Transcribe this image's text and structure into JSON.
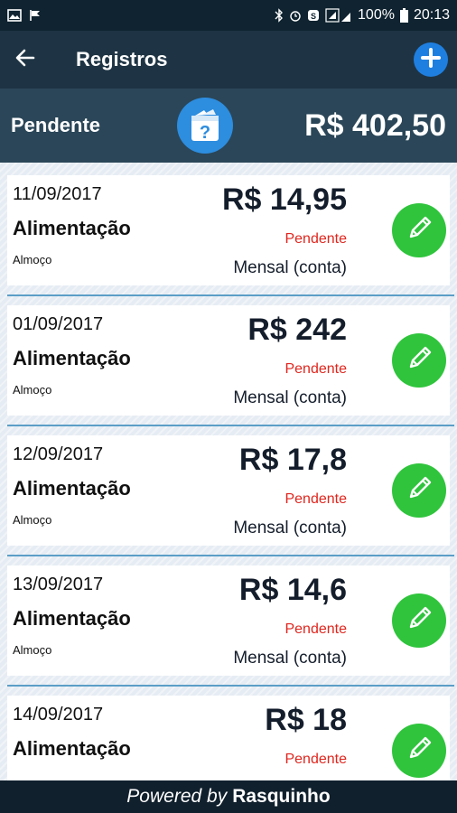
{
  "statusbar": {
    "battery": "100%",
    "time": "20:13"
  },
  "appbar": {
    "title": "Registros"
  },
  "summary": {
    "label": "Pendente",
    "total": "R$ 402,50"
  },
  "records": [
    {
      "date": "11/09/2017",
      "category": "Alimentação",
      "subcategory": "Almoço",
      "amount": "R$ 14,95",
      "status": "Pendente",
      "frequency": "Mensal (conta)"
    },
    {
      "date": "01/09/2017",
      "category": "Alimentação",
      "subcategory": "Almoço",
      "amount": "R$ 242",
      "status": "Pendente",
      "frequency": "Mensal (conta)"
    },
    {
      "date": "12/09/2017",
      "category": "Alimentação",
      "subcategory": "Almoço",
      "amount": "R$ 17,8",
      "status": "Pendente",
      "frequency": "Mensal (conta)"
    },
    {
      "date": "13/09/2017",
      "category": "Alimentação",
      "subcategory": "Almoço",
      "amount": "R$ 14,6",
      "status": "Pendente",
      "frequency": "Mensal (conta)"
    },
    {
      "date": "14/09/2017",
      "category": "Alimentação",
      "subcategory": "",
      "amount": "R$ 18",
      "status": "Pendente",
      "frequency": ""
    }
  ],
  "footer": {
    "powered": "Powered by",
    "brand": "Rasquinho"
  },
  "colors": {
    "appbar": "#1e3444",
    "summary": "#2a4658",
    "add_button": "#1f7fe0",
    "edit_button": "#2fc43c",
    "status_pending": "#e0251d"
  },
  "icons": {
    "back": "arrow-left-icon",
    "add": "plus-circle-icon",
    "summary": "wallet-question-icon",
    "edit": "pencil-icon"
  }
}
